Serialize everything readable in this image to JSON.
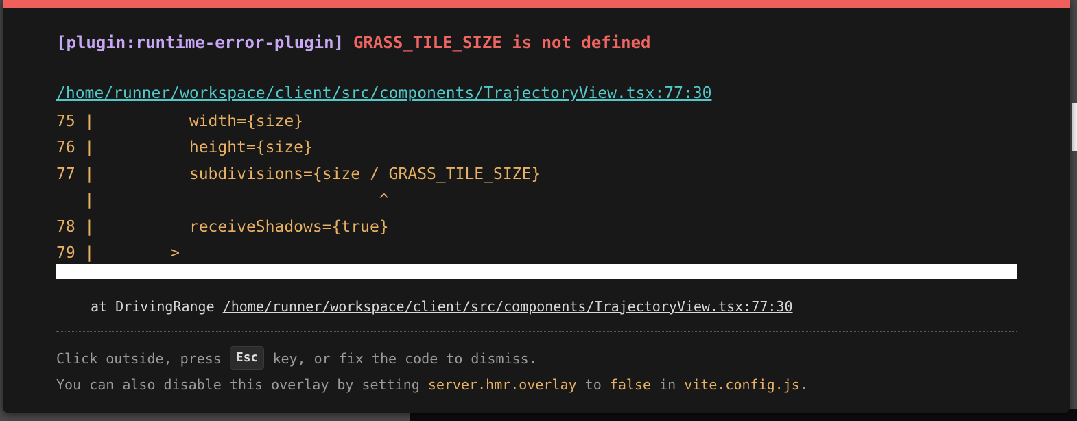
{
  "error": {
    "plugin": "[plugin:runtime-error-plugin]",
    "message": "GRASS_TILE_SIZE is not defined",
    "file_link": "/home/runner/workspace/client/src/components/TrajectoryView.tsx:77:30"
  },
  "frame_lines": [
    "75 |          width={size}",
    "76 |          height={size}",
    "77 |          subdivisions={size / GRASS_TILE_SIZE}",
    "   |                              ^",
    "78 |          receiveShadows={true}",
    "79 |        >"
  ],
  "stack": {
    "prefix": "at DrivingRange",
    "link": "/home/runner/workspace/client/src/components/TrajectoryView.tsx:77:30"
  },
  "tip": {
    "line1_before": "Click outside, press",
    "key": "Esc",
    "line1_after": "key, or fix the code to dismiss.",
    "line2_part1": "You can also disable this overlay by setting",
    "line2_code1": "server.hmr.overlay",
    "line2_part2": "to",
    "line2_code2": "false",
    "line2_part3": "in",
    "line2_code3": "vite.config.js",
    "line2_end": "."
  },
  "colors": {
    "accent_bar": "#ef5f5c",
    "plugin": "#c8a7f5",
    "message": "#ef6562",
    "link": "#52c9c9",
    "code": "#e8b062",
    "background": "#181818"
  }
}
